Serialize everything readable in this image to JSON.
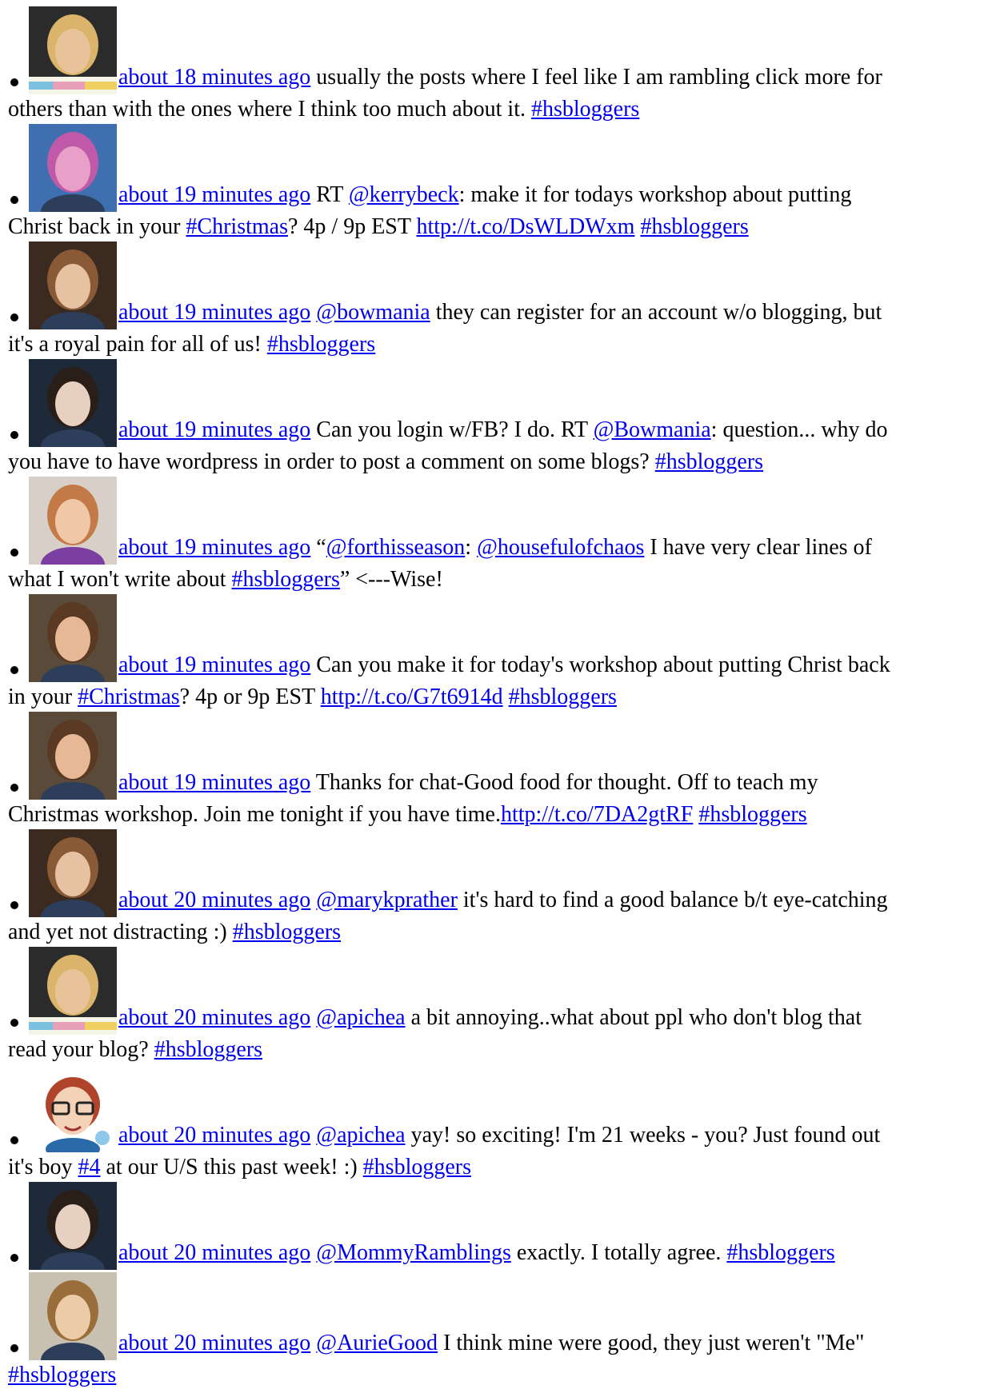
{
  "tweets": [
    {
      "avatar": "woman-blonde-hellomornings-avatar",
      "time": "about 18 minutes ago",
      "line1": [
        {
          "t": "text",
          "v": " usually the posts where I feel like I am rambling click more for"
        }
      ],
      "line2": [
        {
          "t": "text",
          "v": "others than with the ones where I think too much about it. "
        },
        {
          "t": "link",
          "v": "#hsbloggers"
        }
      ]
    },
    {
      "avatar": "woman-pink-photo-avatar",
      "time": "about 19 minutes ago",
      "line1": [
        {
          "t": "text",
          "v": " RT "
        },
        {
          "t": "link",
          "v": "@kerrybeck"
        },
        {
          "t": "text",
          "v": ": make it for todays workshop about putting"
        }
      ],
      "line2": [
        {
          "t": "text",
          "v": "Christ back in your "
        },
        {
          "t": "link",
          "v": "#Christmas"
        },
        {
          "t": "text",
          "v": "? 4p / 9p EST "
        },
        {
          "t": "link",
          "v": "http://t.co/DsWLDWxm"
        },
        {
          "t": "text",
          "v": " "
        },
        {
          "t": "link",
          "v": "#hsbloggers"
        }
      ]
    },
    {
      "avatar": "woman-brown-hair-avatar",
      "time": "about 19 minutes ago",
      "line1": [
        {
          "t": "text",
          "v": " "
        },
        {
          "t": "link",
          "v": "@bowmania"
        },
        {
          "t": "text",
          "v": " they can register for an account w/o blogging, but"
        }
      ],
      "line2": [
        {
          "t": "text",
          "v": "it's a royal pain for all of us! "
        },
        {
          "t": "link",
          "v": "#hsbloggers"
        }
      ]
    },
    {
      "avatar": "woman-dark-hair-avatar",
      "time": "about 19 minutes ago",
      "line1": [
        {
          "t": "text",
          "v": " Can you login w/FB? I do. RT "
        },
        {
          "t": "link",
          "v": "@Bowmania"
        },
        {
          "t": "text",
          "v": ": question... why do"
        }
      ],
      "line2": [
        {
          "t": "text",
          "v": "you have to have wordpress in order to post a comment on some blogs? "
        },
        {
          "t": "link",
          "v": "#hsbloggers"
        }
      ]
    },
    {
      "avatar": "woman-purple-avatar",
      "time": "about 19 minutes ago",
      "line1": [
        {
          "t": "text",
          "v": " “"
        },
        {
          "t": "link",
          "v": "@forthisseason"
        },
        {
          "t": "text",
          "v": ": "
        },
        {
          "t": "link",
          "v": "@housefulofchaos"
        },
        {
          "t": "text",
          "v": " I have very clear lines of"
        }
      ],
      "line2": [
        {
          "t": "text",
          "v": "what I won't write about "
        },
        {
          "t": "link",
          "v": "#hsbloggers"
        },
        {
          "t": "text",
          "v": "” <---Wise!"
        }
      ]
    },
    {
      "avatar": "woman-glasses-avatar",
      "time": "about 19 minutes ago",
      "line1": [
        {
          "t": "text",
          "v": " Can you make it for today's workshop about putting Christ back"
        }
      ],
      "line2": [
        {
          "t": "text",
          "v": "in your "
        },
        {
          "t": "link",
          "v": "#Christmas"
        },
        {
          "t": "text",
          "v": "? 4p or 9p EST "
        },
        {
          "t": "link",
          "v": "http://t.co/G7t6914d"
        },
        {
          "t": "text",
          "v": " "
        },
        {
          "t": "link",
          "v": "#hsbloggers"
        }
      ]
    },
    {
      "avatar": "woman-glasses-avatar",
      "time": "about 19 minutes ago",
      "line1": [
        {
          "t": "text",
          "v": " Thanks for chat-Good food for thought. Off to teach my"
        }
      ],
      "line2": [
        {
          "t": "text",
          "v": "Christmas workshop. Join me tonight if you have time."
        },
        {
          "t": "link",
          "v": "http://t.co/7DA2gtRF"
        },
        {
          "t": "text",
          "v": " "
        },
        {
          "t": "link",
          "v": "#hsbloggers"
        }
      ]
    },
    {
      "avatar": "woman-brown-hair-avatar",
      "time": "about 20 minutes ago",
      "line1": [
        {
          "t": "text",
          "v": " "
        },
        {
          "t": "link",
          "v": "@marykprather"
        },
        {
          "t": "text",
          "v": " it's hard to find a good balance b/t eye-catching"
        }
      ],
      "line2": [
        {
          "t": "text",
          "v": "and yet not distracting :) "
        },
        {
          "t": "link",
          "v": "#hsbloggers"
        }
      ]
    },
    {
      "avatar": "woman-blonde-hellomornings-avatar",
      "time": "about 20 minutes ago",
      "line1": [
        {
          "t": "text",
          "v": " "
        },
        {
          "t": "link",
          "v": "@apichea"
        },
        {
          "t": "text",
          "v": " a bit annoying..what about ppl who don't blog that"
        }
      ],
      "line2": [
        {
          "t": "text",
          "v": "read your blog? "
        },
        {
          "t": "link",
          "v": "#hsbloggers"
        }
      ]
    },
    {
      "avatar": "cartoon-glasses-avatar",
      "time": "about 20 minutes ago",
      "line1": [
        {
          "t": "text",
          "v": " "
        },
        {
          "t": "link",
          "v": "@apichea"
        },
        {
          "t": "text",
          "v": " yay! so exciting! I'm 21 weeks - you? Just found out"
        }
      ],
      "line2": [
        {
          "t": "text",
          "v": "it's boy "
        },
        {
          "t": "link",
          "v": "#4"
        },
        {
          "t": "text",
          "v": " at our U/S this past week! :) "
        },
        {
          "t": "link",
          "v": "#hsbloggers"
        }
      ]
    },
    {
      "avatar": "woman-dark-hair-avatar",
      "time": "about 20 minutes ago",
      "line1": [
        {
          "t": "text",
          "v": " "
        },
        {
          "t": "link",
          "v": "@MommyRamblings"
        },
        {
          "t": "text",
          "v": " exactly. I totally agree. "
        },
        {
          "t": "link",
          "v": "#hsbloggers"
        }
      ],
      "line2": []
    },
    {
      "avatar": "woman-curly-hair-avatar",
      "time": "about 20 minutes ago",
      "line1": [
        {
          "t": "text",
          "v": " "
        },
        {
          "t": "link",
          "v": "@AurieGood"
        },
        {
          "t": "text",
          "v": " I think mine were good, they just weren't \"Me\""
        }
      ],
      "line2": [
        {
          "t": "link",
          "v": "#hsbloggers"
        }
      ]
    }
  ],
  "colors": {
    "link": "#0000ee",
    "text": "#000000",
    "background": "#ffffff"
  }
}
